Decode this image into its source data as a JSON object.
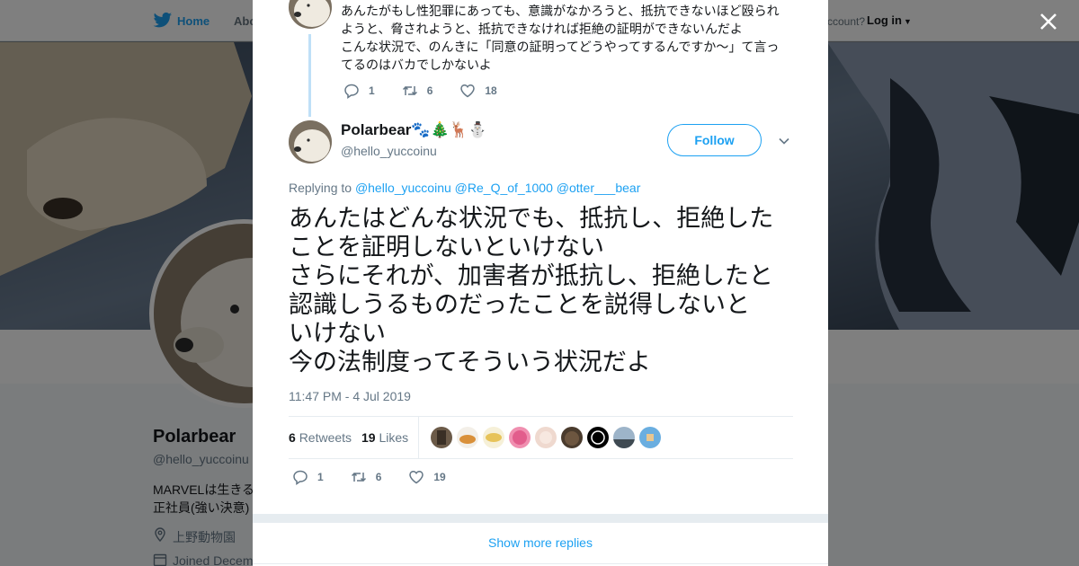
{
  "background": {
    "nav": {
      "home_label": "Home",
      "about_label": "Abo",
      "account_text": "ccount?",
      "login_label": "Log in"
    },
    "profile": {
      "name": "Polarbear",
      "handle": "@hello_yuccoinu",
      "bio_line1": "MARVELは生きる",
      "bio_line2": "正社員(強い決意)",
      "location": "上野動物園",
      "joined": "Joined Decem"
    }
  },
  "modal": {
    "previous_tweet": {
      "lines": [
        "あんたがもし性犯罪にあっても、意識がなかろうと、抵抗できないほど殴られ",
        "ようと、脅されようと、抵抗できなければ拒絶の証明ができないんだよ",
        "こんな状況で、のんきに「同意の証明ってどうやってするんですか〜」て言っ",
        "てるのはバカでしかないよ"
      ],
      "reply_count": "1",
      "retweet_count": "6",
      "like_count": "18"
    },
    "tweet": {
      "author_name": "Polarbear🐾🎄🦌⛄",
      "author_handle": "@hello_yuccoinu",
      "follow_label": "Follow",
      "replying_prefix": "Replying to",
      "replying_to": [
        "@hello_yuccoinu",
        "@Re_Q_of_1000",
        "@otter___bear"
      ],
      "text_lines": [
        "あんたはどんな状況でも、抵抗し、拒絶した",
        "ことを証明しないといけない",
        "さらにそれが、加害者が抵抗し、拒絶したと",
        "認識しうるものだったことを説得しないと",
        "いけない",
        "今の法制度ってそういう状況だよ"
      ],
      "timestamp": "11:47 PM - 4 Jul 2019",
      "retweets_count": "6",
      "retweets_label": "Retweets",
      "likes_count": "19",
      "likes_label": "Likes",
      "reply_count": "1",
      "retweet_count": "6",
      "like_count": "19"
    },
    "show_more_label": "Show more replies"
  },
  "colors": {
    "accent": "#1da1f2",
    "text_primary": "#14171a",
    "text_secondary": "#657786",
    "overlay": "rgba(0,0,0,0.5)"
  },
  "icons": {
    "nav_logo": "twitter-bird-icon",
    "close": "close-icon",
    "reply": "reply-icon",
    "retweet": "retweet-icon",
    "like": "heart-icon",
    "more": "chevron-down-icon",
    "location": "location-icon",
    "calendar": "calendar-icon"
  }
}
